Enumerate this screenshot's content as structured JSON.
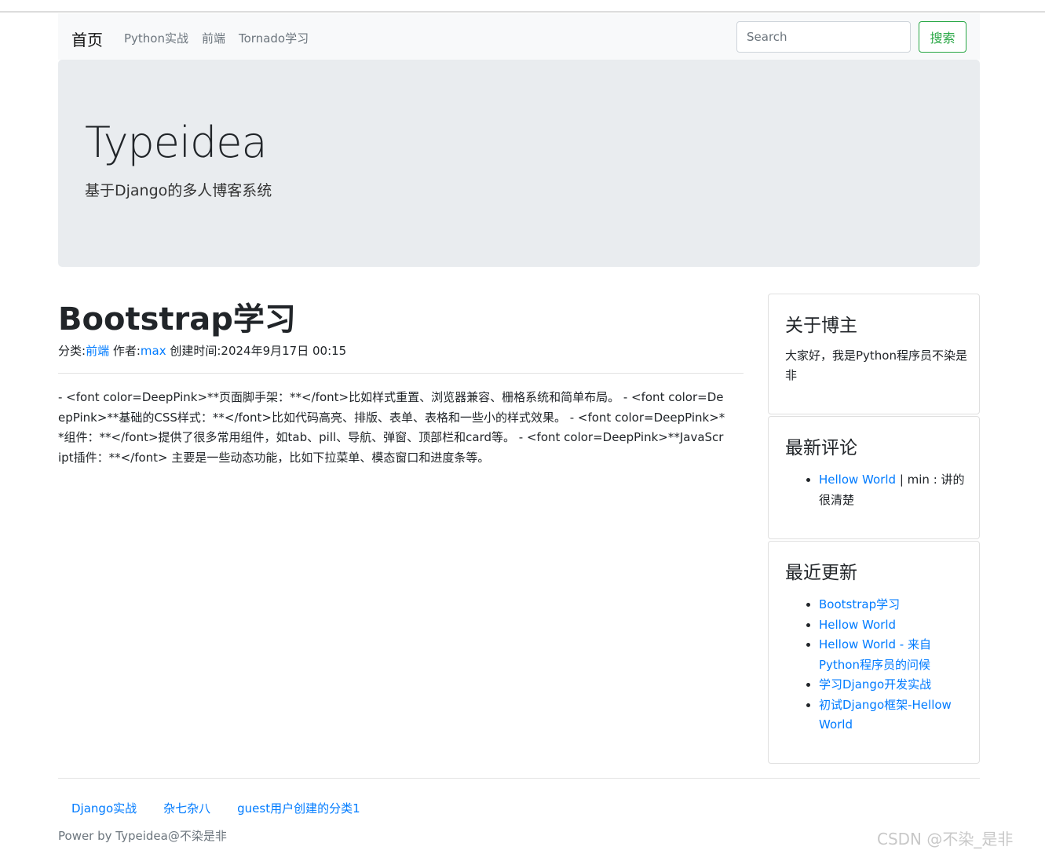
{
  "navbar": {
    "brand": "首页",
    "links": [
      "Python实战",
      "前端",
      "Tornado学习"
    ],
    "search_placeholder": "Search",
    "search_button": "搜索"
  },
  "jumbotron": {
    "title": "Typeidea",
    "subtitle": "基于Django的多人博客系统"
  },
  "post": {
    "title": "Bootstrap学习",
    "category_label": "分类:",
    "category": "前端",
    "author_label": " 作者:",
    "author": "max",
    "created_label": " 创建时间:",
    "created": "2024年9月17日 00:15",
    "body": "- <font color=DeepPink>**页面脚手架：**</font>比如样式重置、浏览器兼容、栅格系统和简单布局。 - <font color=DeepPink>**基础的CSS样式：**</font>比如代码高亮、排版、表单、表格和一些小的样式效果。 - <font color=DeepPink>**组件：**</font>提供了很多常用组件，如tab、pill、导航、弹窗、顶部栏和card等。 - <font color=DeepPink>**JavaScript插件：**</font> 主要是一些动态功能，比如下拉菜单、模态窗口和进度条等。"
  },
  "sidebar": {
    "about": {
      "title": "关于博主",
      "text": "大家好，我是Python程序员不染是非"
    },
    "comments": {
      "title": "最新评论",
      "items": [
        {
          "link": "Hellow World",
          "text": " | min : 讲的很清楚"
        }
      ]
    },
    "recent": {
      "title": "最近更新",
      "items": [
        "Bootstrap学习",
        "Hellow World",
        "Hellow World - 来自Python程序员的问候",
        "学习Django开发实战",
        "初试Django框架-Hellow World"
      ]
    }
  },
  "footer": {
    "links": [
      "Django实战",
      "杂七杂八",
      "guest用户创建的分类1"
    ],
    "powered": "Power by Typeidea@不染是非"
  },
  "watermark": "CSDN @不染_是非",
  "colors": {
    "link": "#007bff",
    "success": "#28a745",
    "jumbotron_bg": "#e9ecef",
    "navbar_bg": "#f8f9fa"
  }
}
